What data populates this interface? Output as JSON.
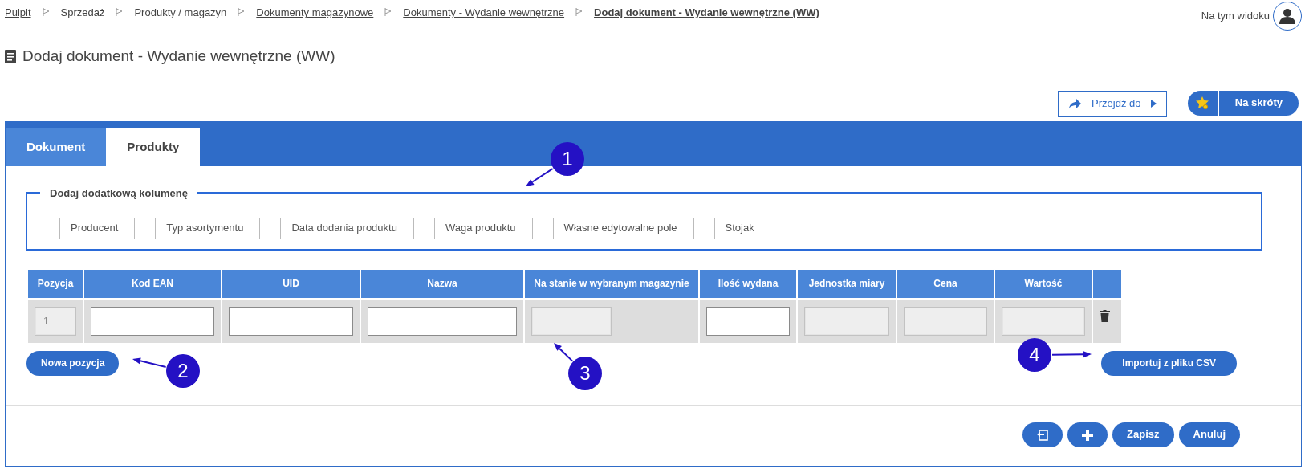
{
  "breadcrumbs": [
    {
      "label": "Pulpit",
      "link": true,
      "current": false
    },
    {
      "label": "Sprzedaż",
      "link": false,
      "current": false
    },
    {
      "label": "Produkty / magazyn",
      "link": false,
      "current": false
    },
    {
      "label": "Dokumenty magazynowe",
      "link": true,
      "current": false
    },
    {
      "label": "Dokumenty - Wydanie wewnętrzne",
      "link": true,
      "current": false
    },
    {
      "label": "Dodaj dokument - Wydanie wewnętrzne (WW)",
      "link": true,
      "current": true
    }
  ],
  "view_menu": {
    "label": "Na tym widoku"
  },
  "page_title": "Dodaj dokument - Wydanie wewnętrzne (WW)",
  "goto_button": {
    "label": "Przejdź do"
  },
  "shortcuts_button": {
    "label": "Na skróty"
  },
  "tabs": [
    {
      "label": "Dokument",
      "selected": false
    },
    {
      "label": "Produkty",
      "selected": true
    }
  ],
  "extra_columns": {
    "legend": "Dodaj dodatkową kolumenę",
    "options": [
      {
        "label": "Producent",
        "checked": false
      },
      {
        "label": "Typ asortymentu",
        "checked": false
      },
      {
        "label": "Data dodania produktu",
        "checked": false
      },
      {
        "label": "Waga produktu",
        "checked": false
      },
      {
        "label": "Własne edytowalne pole",
        "checked": false
      },
      {
        "label": "Stojak",
        "checked": false
      }
    ]
  },
  "table": {
    "columns": [
      "Pozycja",
      "Kod EAN",
      "UID",
      "Nazwa",
      "Na stanie w wybranym magazynie",
      "Ilość wydana",
      "Jednostka miary",
      "Cena",
      "Wartość"
    ],
    "rows": [
      {
        "cells": [
          {
            "value": "1",
            "editable": false
          },
          {
            "editable": true
          },
          {
            "editable": true
          },
          {
            "editable": true
          },
          {
            "editable": false
          },
          {
            "editable": true
          },
          {
            "editable": false
          },
          {
            "editable": false
          },
          {
            "editable": false
          }
        ]
      }
    ]
  },
  "new_position_button": "Nowa pozycja",
  "import_button": "Importuj z pliku CSV",
  "footer_buttons": [
    {
      "kind": "icon-restore"
    },
    {
      "kind": "icon-plus"
    },
    {
      "kind": "text",
      "label": "Zapisz"
    },
    {
      "kind": "text",
      "label": "Anuluj"
    }
  ],
  "annotations": [
    {
      "label": "1"
    },
    {
      "label": "2"
    },
    {
      "label": "3"
    },
    {
      "label": "4"
    }
  ]
}
